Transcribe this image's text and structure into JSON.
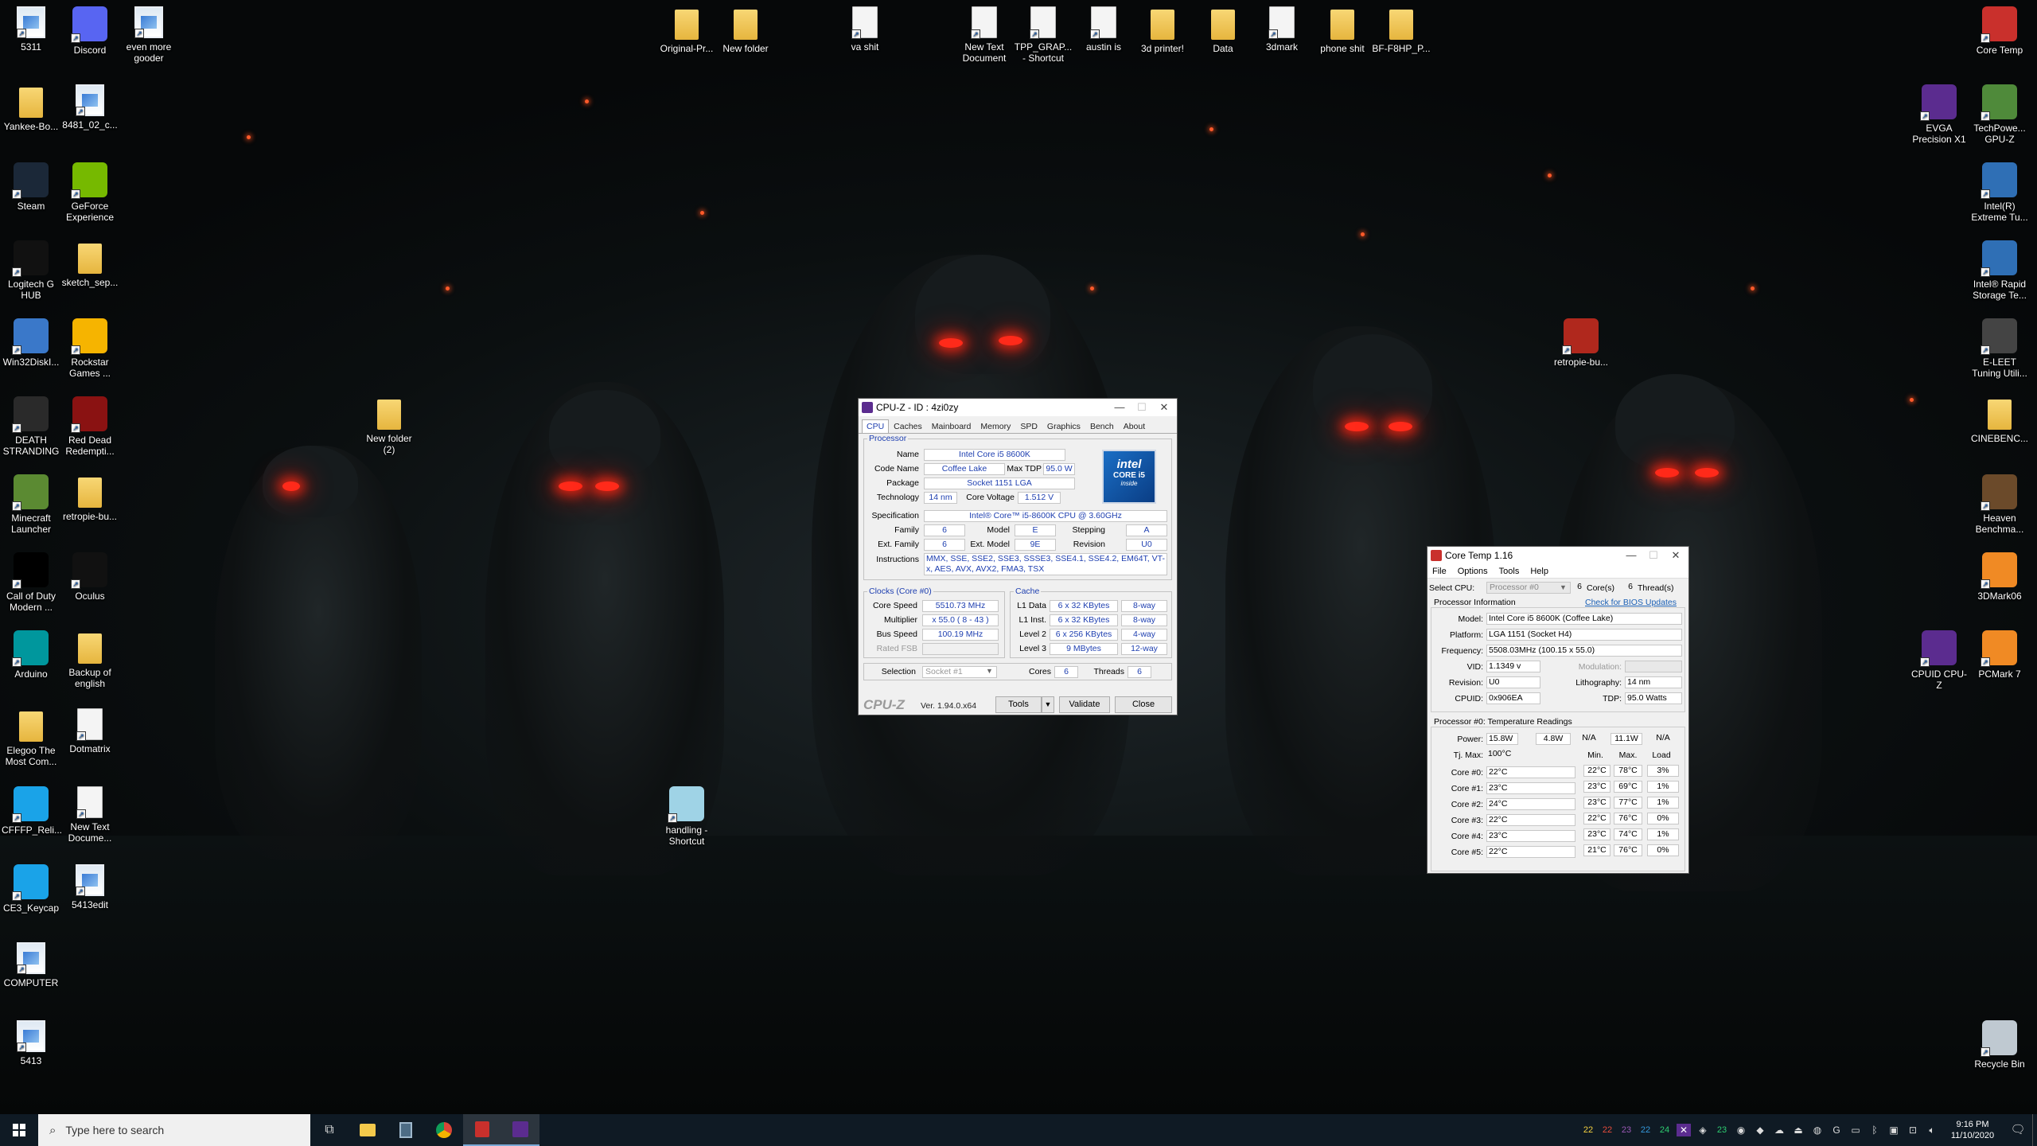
{
  "desktop_icons": [
    {
      "label": "5311",
      "type": "img"
    },
    {
      "label": "Discord",
      "type": "app",
      "color": "#5865f2"
    },
    {
      "label": "even more gooder",
      "type": "img"
    },
    {
      "label": "Yankee-Bo...",
      "type": "folder"
    },
    {
      "label": "8481_02_c...",
      "type": "img"
    },
    {
      "label": "Steam",
      "type": "app",
      "color": "#1b2838"
    },
    {
      "label": "GeForce Experience",
      "type": "app",
      "color": "#76b900"
    },
    {
      "label": "Logitech G HUB",
      "type": "app",
      "color": "#111111"
    },
    {
      "label": "sketch_sep...",
      "type": "folder"
    },
    {
      "label": "Win32DiskI...",
      "type": "app",
      "color": "#3a78c9"
    },
    {
      "label": "Rockstar Games ...",
      "type": "app",
      "color": "#f6b400"
    },
    {
      "label": "DEATH STRANDING",
      "type": "app",
      "color": "#2a2a2a"
    },
    {
      "label": "Red Dead Redempti...",
      "type": "app",
      "color": "#8a1212"
    },
    {
      "label": "Minecraft Launcher",
      "type": "app",
      "color": "#5b8a32"
    },
    {
      "label": "retropie-bu...",
      "type": "folder"
    },
    {
      "label": "Call of Duty Modern ...",
      "type": "app",
      "color": "#000000"
    },
    {
      "label": "Oculus",
      "type": "app",
      "color": "#111111"
    },
    {
      "label": "Arduino",
      "type": "app",
      "color": "#00979d"
    },
    {
      "label": "Backup of english",
      "type": "folder"
    },
    {
      "label": "Elegoo The Most Com...",
      "type": "folder"
    },
    {
      "label": "Dotmatrix",
      "type": "doc"
    },
    {
      "label": "CFFFP_Reli...",
      "type": "app",
      "color": "#1aa3e8"
    },
    {
      "label": "New Text Docume...",
      "type": "doc"
    },
    {
      "label": "CE3_Keycap",
      "type": "app",
      "color": "#1aa3e8"
    },
    {
      "label": "5413edit",
      "type": "img"
    },
    {
      "label": "COMPUTER",
      "type": "img"
    },
    {
      "label": "5413",
      "type": "img"
    },
    {
      "label": "Original-Pr...",
      "type": "folder"
    },
    {
      "label": "New folder",
      "type": "folder"
    },
    {
      "label": "va shit",
      "type": "doc"
    },
    {
      "label": "New Text Document",
      "type": "doc"
    },
    {
      "label": "TPP_GRAP... - Shortcut",
      "type": "doc"
    },
    {
      "label": "austin is",
      "type": "doc"
    },
    {
      "label": "3d printer!",
      "type": "folder"
    },
    {
      "label": "Data",
      "type": "folder"
    },
    {
      "label": "3dmark",
      "type": "doc"
    },
    {
      "label": "phone shit",
      "type": "folder"
    },
    {
      "label": "BF-F8HP_P...",
      "type": "folder"
    },
    {
      "label": "New folder (2)",
      "type": "folder"
    },
    {
      "label": "handling - Shortcut",
      "type": "app",
      "color": "#9fd3e6"
    },
    {
      "label": "retropie-bu...",
      "type": "app",
      "color": "#b0281d"
    },
    {
      "label": "Core Temp",
      "type": "app",
      "color": "#c9302c"
    },
    {
      "label": "EVGA Precision X1",
      "type": "app",
      "color": "#5b2c8f"
    },
    {
      "label": "TechPowe... GPU-Z",
      "type": "app",
      "color": "#4f8a3a"
    },
    {
      "label": "Intel(R) Extreme Tu...",
      "type": "app",
      "color": "#2f6fb5"
    },
    {
      "label": "Intel® Rapid Storage Te...",
      "type": "app",
      "color": "#2f6fb5"
    },
    {
      "label": "E-LEET Tuning Utili...",
      "type": "app",
      "color": "#444444"
    },
    {
      "label": "CINEBENC...",
      "type": "folder"
    },
    {
      "label": "Heaven Benchma...",
      "type": "app",
      "color": "#6b4a2a"
    },
    {
      "label": "3DMark06",
      "type": "app",
      "color": "#f08a24"
    },
    {
      "label": "CPUID CPU-Z",
      "type": "app",
      "color": "#5b2c8f"
    },
    {
      "label": "PCMark 7",
      "type": "app",
      "color": "#f08a24"
    },
    {
      "label": "Recycle Bin",
      "type": "app",
      "color": "#bfc9d1"
    }
  ],
  "cpuz": {
    "title": "CPU-Z - ID : 4zi0zy",
    "tabs": [
      "CPU",
      "Caches",
      "Mainboard",
      "Memory",
      "SPD",
      "Graphics",
      "Bench",
      "About"
    ],
    "active_tab": "CPU",
    "processor_legend": "Processor",
    "name_label": "Name",
    "name": "Intel Core i5 8600K",
    "codename_label": "Code Name",
    "codename": "Coffee Lake",
    "maxtdp_label": "Max TDP",
    "maxtdp": "95.0 W",
    "package_label": "Package",
    "package": "Socket 1151 LGA",
    "technology_label": "Technology",
    "technology": "14 nm",
    "corevoltage_label": "Core Voltage",
    "corevoltage": "1.512 V",
    "spec_label": "Specification",
    "spec": "Intel® Core™ i5-8600K CPU @ 3.60GHz",
    "family_label": "Family",
    "family": "6",
    "model_label": "Model",
    "model": "E",
    "stepping_label": "Stepping",
    "stepping": "A",
    "extfamily_label": "Ext. Family",
    "extfamily": "6",
    "extmodel_label": "Ext. Model",
    "extmodel": "9E",
    "revision_label": "Revision",
    "revision": "U0",
    "instructions_label": "Instructions",
    "instructions": "MMX, SSE, SSE2, SSE3, SSSE3, SSE4.1, SSE4.2, EM64T, VT-x, AES, AVX, AVX2, FMA3, TSX",
    "clocks_legend": "Clocks (Core #0)",
    "corespeed_label": "Core Speed",
    "corespeed": "5510.73 MHz",
    "multiplier_label": "Multiplier",
    "multiplier": "x 55.0 ( 8 - 43 )",
    "busspeed_label": "Bus Speed",
    "busspeed": "100.19 MHz",
    "ratedfsb_label": "Rated FSB",
    "cache_legend": "Cache",
    "l1d_label": "L1 Data",
    "l1d": "6 x 32 KBytes",
    "l1d_way": "8-way",
    "l1i_label": "L1 Inst.",
    "l1i": "6 x 32 KBytes",
    "l1i_way": "8-way",
    "l2_label": "Level 2",
    "l2": "6 x 256 KBytes",
    "l2_way": "4-way",
    "l3_label": "Level 3",
    "l3": "9 MBytes",
    "l3_way": "12-way",
    "selection_label": "Selection",
    "selection": "Socket #1",
    "cores_label": "Cores",
    "cores": "6",
    "threads_label": "Threads",
    "threads": "6",
    "brand": "CPU-Z",
    "version": "Ver. 1.94.0.x64",
    "tools_btn": "Tools",
    "validate_btn": "Validate",
    "close_btn": "Close",
    "intel_badge_top": "intel",
    "intel_badge_mid": "CORE i5",
    "intel_badge_bot": "inside"
  },
  "coretemp": {
    "title": "Core Temp 1.16",
    "menu": [
      "File",
      "Options",
      "Tools",
      "Help"
    ],
    "select_cpu_label": "Select CPU:",
    "select_cpu": "Processor #0",
    "cores_count": "6",
    "cores_label": "Core(s)",
    "threads_count": "6",
    "threads_label": "Thread(s)",
    "proc_info_label": "Processor Information",
    "bios_link": "Check for BIOS Updates",
    "model_label": "Model:",
    "model": "Intel Core i5 8600K (Coffee Lake)",
    "platform_label": "Platform:",
    "platform": "LGA 1151 (Socket H4)",
    "frequency_label": "Frequency:",
    "frequency": "5508.03MHz (100.15 x 55.0)",
    "vid_label": "VID:",
    "vid": "1.1349 v",
    "modulation_label": "Modulation:",
    "revision_label": "Revision:",
    "revision": "U0",
    "lithography_label": "Lithography:",
    "lithography": "14 nm",
    "cpuid_label": "CPUID:",
    "cpuid": "0x906EA",
    "tdp_label": "TDP:",
    "tdp": "95.0 Watts",
    "temps_label": "Processor #0: Temperature Readings",
    "power_label": "Power:",
    "power": [
      "15.8W",
      "4.8W",
      "N/A",
      "11.1W",
      "N/A"
    ],
    "tjmax_label": "Tj. Max:",
    "tjmax": "100°C",
    "min_label": "Min.",
    "max_label": "Max.",
    "load_label": "Load",
    "cores": [
      {
        "name": "Core #0:",
        "temp": "22°C",
        "min": "22°C",
        "max": "78°C",
        "load": "3%"
      },
      {
        "name": "Core #1:",
        "temp": "23°C",
        "min": "23°C",
        "max": "69°C",
        "load": "1%"
      },
      {
        "name": "Core #2:",
        "temp": "24°C",
        "min": "23°C",
        "max": "77°C",
        "load": "1%"
      },
      {
        "name": "Core #3:",
        "temp": "22°C",
        "min": "22°C",
        "max": "76°C",
        "load": "0%"
      },
      {
        "name": "Core #4:",
        "temp": "23°C",
        "min": "23°C",
        "max": "74°C",
        "load": "1%"
      },
      {
        "name": "Core #5:",
        "temp": "22°C",
        "min": "21°C",
        "max": "76°C",
        "load": "0%"
      }
    ]
  },
  "taskbar": {
    "search_placeholder": "Type here to search",
    "tray_temps": [
      "22",
      "22",
      "23",
      "22",
      "24"
    ],
    "tray_temp_colors": [
      "#f4d03f",
      "#e74c3c",
      "#9b59b6",
      "#3498db",
      "#2ecc71"
    ],
    "tray_temp2": "23",
    "time": "9:16 PM",
    "date": "11/10/2020"
  }
}
